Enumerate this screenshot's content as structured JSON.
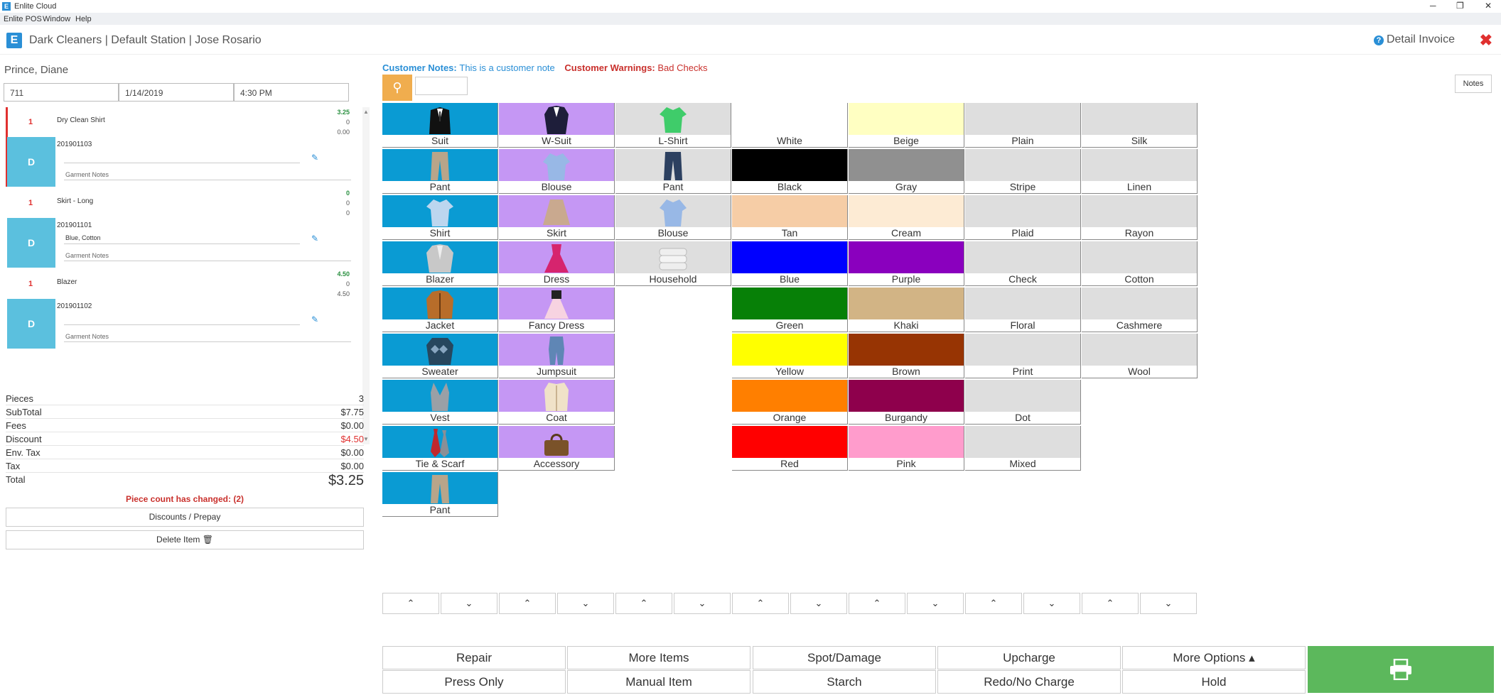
{
  "window": {
    "title": "Enlite Cloud",
    "app_icon_letter": "E",
    "controls": {
      "minimize": "─",
      "restore": "❐",
      "close": "✕"
    }
  },
  "menu": {
    "items": [
      "Enlite POS",
      "Window",
      "Help"
    ]
  },
  "header": {
    "logo_letter": "E",
    "title": "Dark Cleaners | Default Station | Jose Rosario",
    "detail_label": "Detail Invoice",
    "help_glyph": "?",
    "close_glyph": "✖"
  },
  "customer": {
    "name": "Prince, Diane",
    "ticket": "711",
    "date": "1/14/2019",
    "time": "4:30 PM"
  },
  "items": [
    {
      "qty": "1",
      "name": "Dry Clean Shirt",
      "prices": [
        "3.25",
        "0",
        "0.00"
      ],
      "dept": "D",
      "tag": "201901103",
      "attributes": "",
      "notes_label": "Garment Notes"
    },
    {
      "qty": "1",
      "name": "Skirt - Long",
      "prices": [
        "0",
        "0",
        "0"
      ],
      "dept": "D",
      "tag": "201901101",
      "attributes": "Blue, Cotton",
      "notes_label": "Garment Notes"
    },
    {
      "qty": "1",
      "name": "Blazer",
      "prices": [
        "4.50",
        "0",
        "4.50"
      ],
      "dept": "D",
      "tag": "201901102",
      "attributes": "",
      "notes_label": "Garment Notes"
    }
  ],
  "edit_icon": "✎",
  "totals": {
    "pieces_label": "Pieces",
    "pieces": "3",
    "subtotal_label": "SubTotal",
    "subtotal": "$7.75",
    "fees_label": "Fees",
    "fees": "$0.00",
    "discount_label": "Discount",
    "discount": "$4.50",
    "envtax_label": "Env. Tax",
    "envtax": "$0.00",
    "tax_label": "Tax",
    "tax": "$0.00",
    "total_label": "Total",
    "total": "$3.25"
  },
  "warning": "Piece count has changed: (2)",
  "buttons": {
    "discounts": "Discounts / Prepay",
    "delete": "Delete Item 🗑",
    "notes": "Notes"
  },
  "customer_notes": {
    "label": "Customer Notes:",
    "value": "This is a customer note",
    "warn_label": "Customer Warnings:",
    "warn_value": "Bad Checks"
  },
  "search_icon": "🔍",
  "columns": [
    {
      "items": [
        {
          "label": "Suit",
          "bg": "#0a9bd3",
          "icon": "suit-icon"
        },
        {
          "label": "Pant",
          "bg": "#0a9bd3",
          "icon": "pant-icon"
        },
        {
          "label": "Shirt",
          "bg": "#0a9bd3",
          "icon": "shirt-icon"
        },
        {
          "label": "Blazer",
          "bg": "#0a9bd3",
          "icon": "blazer-icon"
        },
        {
          "label": "Jacket",
          "bg": "#0a9bd3",
          "icon": "jacket-icon"
        },
        {
          "label": "Sweater",
          "bg": "#0a9bd3",
          "icon": "sweater-icon"
        },
        {
          "label": "Vest",
          "bg": "#0a9bd3",
          "icon": "vest-icon"
        },
        {
          "label": "Tie & Scarf",
          "bg": "#0a9bd3",
          "icon": "tie-icon"
        },
        {
          "label": "Pant",
          "bg": "#0a9bd3",
          "icon": "pant-icon"
        }
      ]
    },
    {
      "items": [
        {
          "label": "W-Suit",
          "bg": "#c597f4",
          "icon": "womens-suit-icon"
        },
        {
          "label": "Blouse",
          "bg": "#c597f4",
          "icon": "blouse-icon"
        },
        {
          "label": "Skirt",
          "bg": "#c597f4",
          "icon": "skirt-icon"
        },
        {
          "label": "Dress",
          "bg": "#c597f4",
          "icon": "dress-icon"
        },
        {
          "label": "Fancy Dress",
          "bg": "#c597f4",
          "icon": "fancy-dress-icon"
        },
        {
          "label": "Jumpsuit",
          "bg": "#c597f4",
          "icon": "jumpsuit-icon"
        },
        {
          "label": "Coat",
          "bg": "#c597f4",
          "icon": "coat-icon"
        },
        {
          "label": "Accessory",
          "bg": "#c597f4",
          "icon": "handbag-icon"
        }
      ]
    },
    {
      "items": [
        {
          "label": "L-Shirt",
          "bg": "#dedede",
          "icon": "tshirt-icon"
        },
        {
          "label": "Pant",
          "bg": "#dedede",
          "icon": "jeans-icon"
        },
        {
          "label": "Blouse",
          "bg": "#dedede",
          "icon": "blouse-icon"
        },
        {
          "label": "Household",
          "bg": "#dedede",
          "icon": "blanket-icon"
        }
      ]
    },
    {
      "items": [
        {
          "label": "White",
          "bg": "#ffffff"
        },
        {
          "label": "Black",
          "bg": "#000000"
        },
        {
          "label": "Tan",
          "bg": "#f6cda6"
        },
        {
          "label": "Blue",
          "bg": "#0000ff"
        },
        {
          "label": "Green",
          "bg": "#078007"
        },
        {
          "label": "Yellow",
          "bg": "#ffff00"
        },
        {
          "label": "Orange",
          "bg": "#ff7f00"
        },
        {
          "label": "Red",
          "bg": "#ff0000"
        }
      ]
    },
    {
      "items": [
        {
          "label": "Beige",
          "bg": "#ffffc2"
        },
        {
          "label": "Gray",
          "bg": "#909090"
        },
        {
          "label": "Cream",
          "bg": "#fdebd4"
        },
        {
          "label": "Purple",
          "bg": "#8a00be"
        },
        {
          "label": "Khaki",
          "bg": "#d2b485"
        },
        {
          "label": "Brown",
          "bg": "#973403"
        },
        {
          "label": "Burgandy",
          "bg": "#8e004c"
        },
        {
          "label": "Pink",
          "bg": "#ff9ccc"
        }
      ]
    },
    {
      "items": [
        {
          "label": "Plain",
          "bg": "#dedede"
        },
        {
          "label": "Stripe",
          "bg": "#dedede"
        },
        {
          "label": "Plaid",
          "bg": "#dedede"
        },
        {
          "label": "Check",
          "bg": "#dedede"
        },
        {
          "label": "Floral",
          "bg": "#dedede"
        },
        {
          "label": "Print",
          "bg": "#dedede"
        },
        {
          "label": "Dot",
          "bg": "#dedede"
        },
        {
          "label": "Mixed",
          "bg": "#dedede"
        }
      ]
    },
    {
      "items": [
        {
          "label": "Silk",
          "bg": "#dedede"
        },
        {
          "label": "Linen",
          "bg": "#dedede"
        },
        {
          "label": "Rayon",
          "bg": "#dedede"
        },
        {
          "label": "Cotton",
          "bg": "#dedede"
        },
        {
          "label": "Cashmere",
          "bg": "#dedede"
        },
        {
          "label": "Wool",
          "bg": "#dedede"
        }
      ]
    }
  ],
  "scroll": {
    "up": "⌃",
    "down": "⌄"
  },
  "actions": {
    "repair": "Repair",
    "more_items": "More Items",
    "spot_damage": "Spot/Damage",
    "upcharge": "Upcharge",
    "more_options": "More Options ▴",
    "press_only": "Press Only",
    "manual_item": "Manual Item",
    "starch": "Starch",
    "redo": "Redo/No Charge",
    "hold": "Hold",
    "print_icon": "printer-icon"
  }
}
